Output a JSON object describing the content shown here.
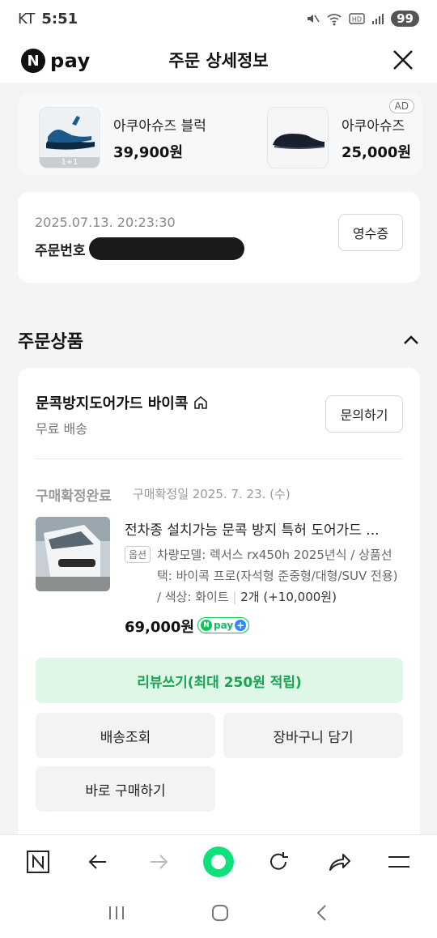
{
  "status_bar": {
    "carrier": "KT",
    "time": "5:51",
    "battery": "99"
  },
  "header": {
    "logo_n": "N",
    "logo_text": "pay",
    "title": "주문 상세정보"
  },
  "ads": {
    "badge": "AD",
    "items": [
      {
        "name": "아쿠아슈즈 블럭",
        "price": "39,900원",
        "thumb_tag": "1+1"
      },
      {
        "name": "아쿠아슈즈",
        "price": "25,000원"
      }
    ]
  },
  "order_info": {
    "datetime": "2025.07.13. 20:23:30",
    "order_no_label": "주문번호",
    "receipt_button": "영수증"
  },
  "section": {
    "title": "주문상품"
  },
  "store": {
    "name": "문콕방지도어가드 바이콕",
    "shipping": "무료 배송",
    "inquiry_button": "문의하기"
  },
  "product": {
    "status": "구매확정완료",
    "confirm_date": "구매확정일 2025. 7. 23. (수)",
    "title": "전차종 설치가능 문콕 방지 특허 도어가드 ...",
    "option_badge": "옵션",
    "option_text": "차량모델: 렉서스 rx450h 2025년식 / 상품선택: 바이콕 프로(자석형 준중형/대형/SUV 전용) / 색상: 화이트",
    "quantity": "2개 (+10,000원)",
    "price": "69,000원",
    "npay_text": "pay"
  },
  "actions": {
    "review": "리뷰쓰기(최대 250원 적립)",
    "track": "배송조회",
    "cart": "장바구니 담기",
    "buy_now": "바로 구매하기"
  },
  "colors": {
    "brand_green": "#03c75a",
    "review_bg": "#dff7e6",
    "review_text": "#1aa352"
  }
}
